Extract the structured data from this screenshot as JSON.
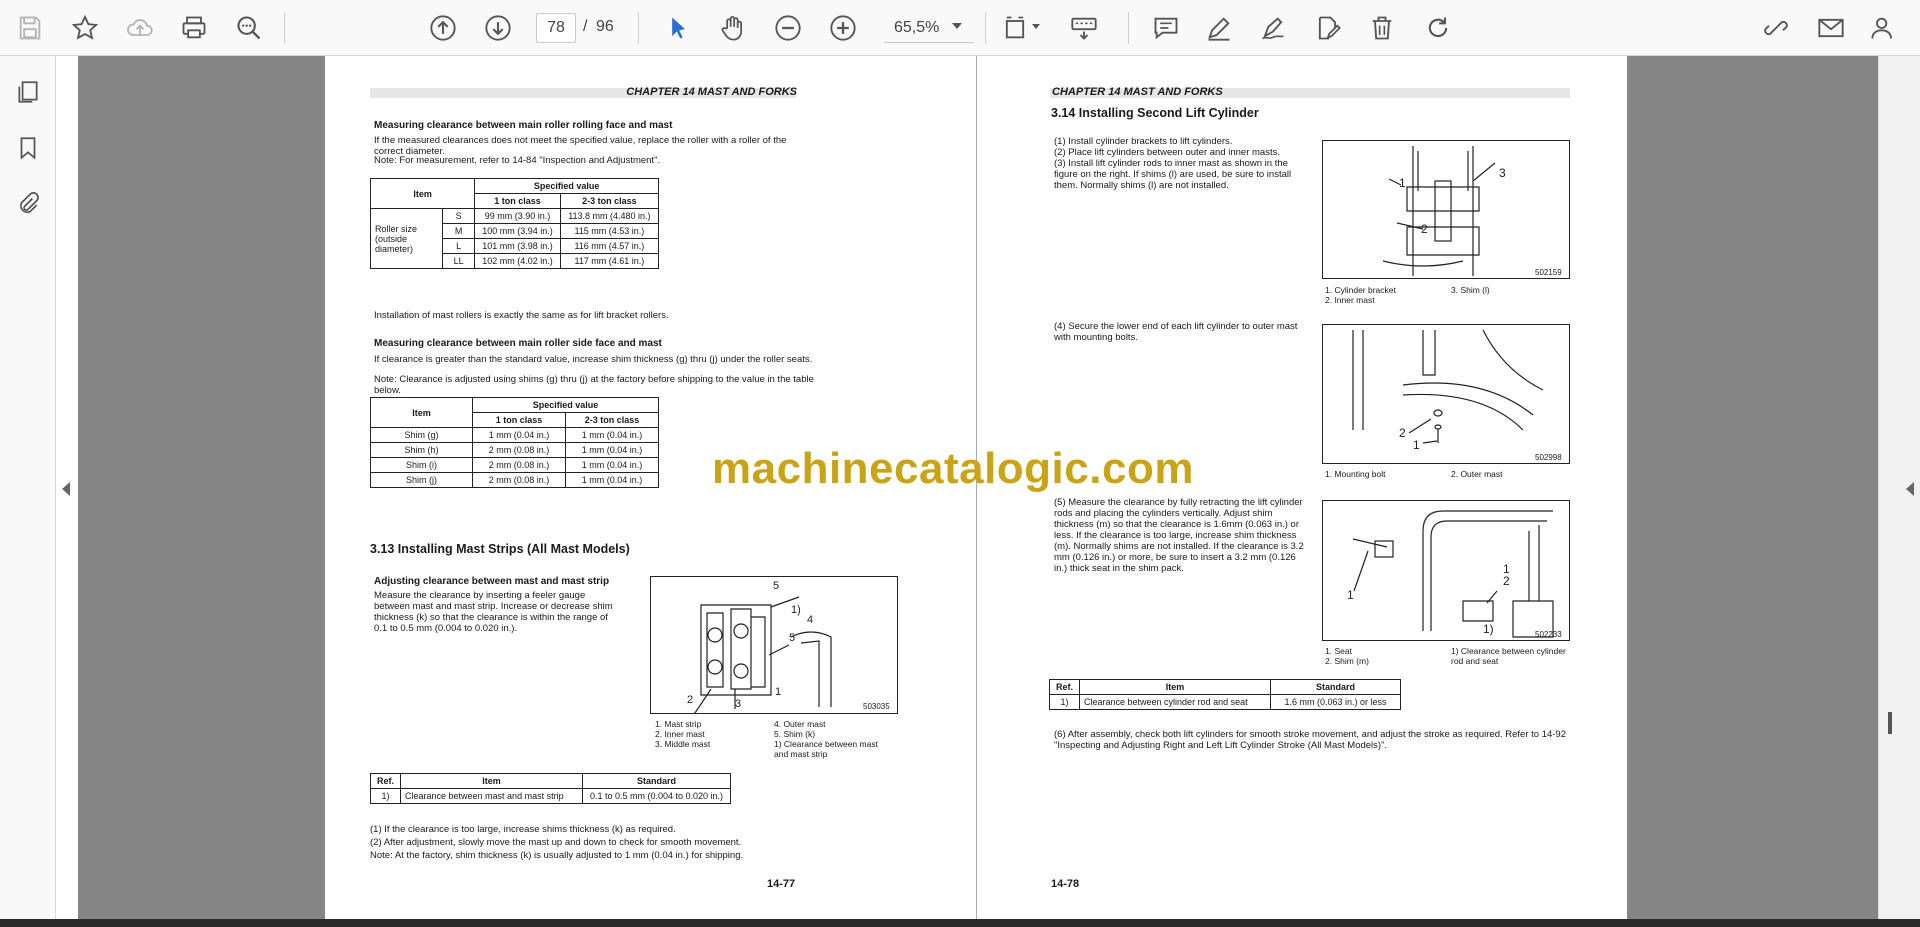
{
  "toolbar": {
    "page_current": "78",
    "page_total": "96",
    "page_separator": "/",
    "zoom": "65,5%"
  },
  "watermark": "machinecatalogic.com",
  "left_page": {
    "chapter": "CHAPTER 14 MAST AND FORKS",
    "h_roll": "Measuring clearance between main roller rolling face and mast",
    "p_roll1": "If the measured clearances does not meet the specified value, replace the roller with a roller of the correct diameter.",
    "p_roll2": "Note: For measurement, refer to 14-84 \"Inspection and Adjustment\".",
    "table1": {
      "item": "Item",
      "spec": "Specified value",
      "c1": "1 ton class",
      "c2": "2-3 ton class",
      "group": "Roller size (outside diameter)",
      "rows": [
        {
          "s": "S",
          "a": "99 mm (3.90 in.)",
          "b": "113.8 mm (4.480 in.)"
        },
        {
          "s": "M",
          "a": "100 mm (3.94 in.)",
          "b": "115 mm (4.53 in.)"
        },
        {
          "s": "L",
          "a": "101 mm (3.98 in.)",
          "b": "116 mm (4.57 in.)"
        },
        {
          "s": "LL",
          "a": "102 mm (4.02 in.)",
          "b": "117 mm (4.61 in.)"
        }
      ]
    },
    "p_install": "Installation of mast rollers is exactly the same as for lift bracket rollers.",
    "h_side": "Measuring clearance between main roller side face and mast",
    "p_side1": "If clearance is greater than the standard value, increase shim thickness (g) thru (j) under the roller seats.",
    "p_side2": "Note: Clearance is adjusted using shims (g) thru (j) at the factory before shipping to the value in the table below.",
    "table2": {
      "item": "Item",
      "spec": "Specified value",
      "c1": "1 ton class",
      "c2": "2-3 ton class",
      "rows": [
        {
          "s": "Shim (g)",
          "a": "1 mm (0.04 in.)",
          "b": "1 mm (0.04 in.)"
        },
        {
          "s": "Shim (h)",
          "a": "2 mm (0.08 in.)",
          "b": "1 mm (0.04 in.)"
        },
        {
          "s": "Shim (i)",
          "a": "2 mm (0.08 in.)",
          "b": "1 mm (0.04 in.)"
        },
        {
          "s": "Shim (j)",
          "a": "2 mm (0.08 in.)",
          "b": "1 mm (0.04 in.)"
        }
      ]
    },
    "h_313": "3.13   Installing Mast Strips (All Mast Models)",
    "h_adj": "Adjusting clearance between mast and mast strip",
    "p_adj": "Measure the clearance by inserting a feeler gauge between mast and mast strip. Increase or decrease shim thickness (k) so that the clearance is within the range of 0.1 to 0.5 mm (0.004 to 0.020 in.).",
    "fig_id": "503035",
    "cap_l": [
      "1.  Mast strip",
      "2.  Inner mast",
      "3.  Middle mast"
    ],
    "cap_r": [
      "4.  Outer mast",
      "5.  Shim (k)",
      "1)  Clearance between mast and mast strip"
    ],
    "table3": {
      "ref": "Ref.",
      "item": "Item",
      "std": "Standard",
      "r": "1)",
      "i": "Clearance between mast and mast strip",
      "s": "0.1 to 0.5 mm (0.004 to 0.020 in.)"
    },
    "notes": [
      "(1)   If the clearance is too large, increase shims thickness (k) as required.",
      "(2)   After adjustment, slowly move the mast up and down to check for smooth movement.",
      "Note: At the factory, shim thickness (k) is usually adjusted to 1 mm (0.04 in.) for shipping."
    ],
    "page_number": "14-77"
  },
  "right_page": {
    "chapter": "CHAPTER 14 MAST AND FORKS",
    "h_314": "3.14    Installing Second Lift Cylinder",
    "steps1": [
      "(1)   Install cylinder brackets to lift cylinders.",
      "(2)   Place lift cylinders between outer and inner masts.",
      "(3)   Install lift cylinder rods to inner mast as shown in the figure on the right. If shims (l) are used, be sure to install them. Normally shims (l) are not installed."
    ],
    "fig1_id": "502159",
    "fig1_cap_l": [
      "1.  Cylinder bracket",
      "2.  Inner mast"
    ],
    "fig1_cap_r": [
      "3.  Shim (l)"
    ],
    "step4": "(4)   Secure the lower end of each lift cylinder to outer mast with mounting bolts.",
    "fig2_id": "502998",
    "fig2_cap_l": "1.  Mounting bolt",
    "fig2_cap_r": "2.  Outer mast",
    "step5": "(5)   Measure the clearance by fully retracting the lift cylinder rods and placing the cylinders vertically. Adjust shim thickness (m) so that the clearance is 1.6mm (0.063 in.) or less. If the clearance is too large, increase shim thickness (m). Normally shims are not installed. If the clearance is 3.2 mm (0.126 in.) or more, be sure to insert a 3.2 mm (0.126 in.) thick seat in the shim pack.",
    "fig3_id": "502233",
    "fig3_cap_l": [
      "1.  Seat",
      "2.  Shim (m)"
    ],
    "fig3_cap_r": [
      "1)  Clearance between cylinder rod and seat"
    ],
    "table4": {
      "ref": "Ref.",
      "item": "Item",
      "std": "Standard",
      "r": "1)",
      "i": "Clearance between cylinder rod and seat",
      "s": "1.6 mm (0.063 in.) or less"
    },
    "step6": "(6)   After assembly, check both lift cylinders for smooth stroke movement, and adjust the stroke as required. Refer to 14-92 \"Inspecting and Adjusting Right and Left Lift Cylinder Stroke (All Mast Models)\".",
    "page_number": "14-78"
  }
}
